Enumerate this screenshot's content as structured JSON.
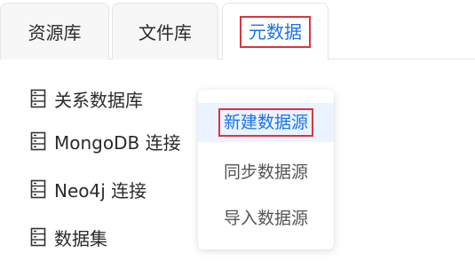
{
  "tabs": [
    {
      "label": "资源库",
      "active": false
    },
    {
      "label": "文件库",
      "active": false
    },
    {
      "label": "元数据",
      "active": true
    }
  ],
  "tree": {
    "items": [
      {
        "label": "关系数据库",
        "icon": "database-icon"
      },
      {
        "label": "MongoDB 连接",
        "icon": "database-icon"
      },
      {
        "label": "Neo4j 连接",
        "icon": "database-icon"
      },
      {
        "label": "数据集",
        "icon": "database-icon"
      }
    ]
  },
  "context_menu": {
    "items": [
      {
        "label": "新建数据源",
        "highlighted": true
      },
      {
        "label": "同步数据源",
        "highlighted": false
      },
      {
        "label": "导入数据源",
        "highlighted": false
      }
    ]
  },
  "colors": {
    "accent": "#1a73e8",
    "highlight_border": "#d9363e",
    "hover_background": "#eaf3ff"
  }
}
